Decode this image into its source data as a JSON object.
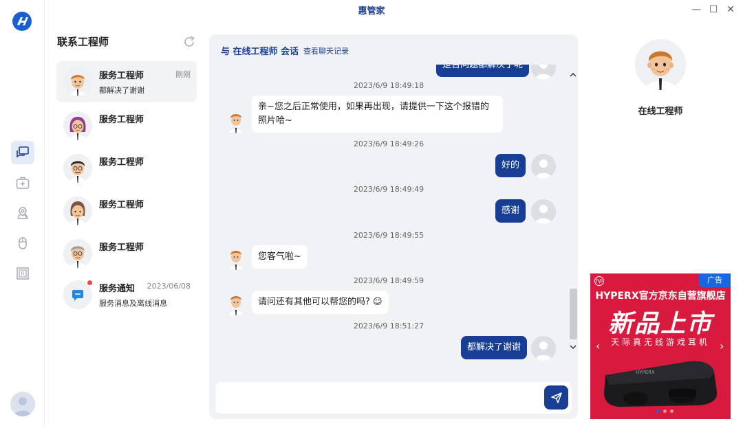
{
  "window": {
    "title": "惠管家",
    "minimize_label": "—",
    "maximize_label": "☐",
    "close_label": "✕"
  },
  "rail": {
    "items": [
      {
        "name": "chat-icon",
        "active": true
      },
      {
        "name": "medical-kit-icon",
        "active": false
      },
      {
        "name": "location-icon",
        "active": false
      },
      {
        "name": "mouse-icon",
        "active": false
      },
      {
        "name": "registered-icon",
        "active": false
      }
    ]
  },
  "contacts": {
    "title": "联系工程师",
    "items": [
      {
        "name": "服务工程师",
        "time": "刚刚",
        "last_message": "都解决了谢谢",
        "selected": true
      },
      {
        "name": "服务工程师",
        "time": "",
        "last_message": "",
        "selected": false
      },
      {
        "name": "服务工程师",
        "time": "",
        "last_message": "",
        "selected": false
      },
      {
        "name": "服务工程师",
        "time": "",
        "last_message": "",
        "selected": false
      },
      {
        "name": "服务工程师",
        "time": "",
        "last_message": "",
        "selected": false
      },
      {
        "name": "服务通知",
        "time": "2023/06/08",
        "last_message": "服务消息及离线消息",
        "selected": false
      }
    ]
  },
  "chat": {
    "title": "与 在线工程师 会话",
    "history_link": "查看聊天记录",
    "partial_top_message": "是否问题都解决了呢",
    "messages": [
      {
        "time": "2023/6/9 18:49:18",
        "from": "engineer",
        "text": "亲~您之后正常使用，如果再出现，请提供一下这个报错的照片哈~"
      },
      {
        "time": "2023/6/9 18:49:26",
        "from": "user",
        "text": "好的"
      },
      {
        "time": "2023/6/9 18:49:49",
        "from": "user",
        "text": "感谢"
      },
      {
        "time": "2023/6/9 18:49:55",
        "from": "engineer",
        "text": "您客气啦~"
      },
      {
        "time": "2023/6/9 18:49:59",
        "from": "engineer",
        "text": "请问还有其他可以帮您的吗? ☺"
      },
      {
        "time": "2023/6/9 18:51:27",
        "from": "user",
        "text": "都解决了谢谢"
      }
    ],
    "input_value": "",
    "input_placeholder": ""
  },
  "engineer_panel": {
    "name": "在线工程师"
  },
  "ad": {
    "tag": "广告",
    "brand_mark": "hp",
    "headline": "HYPERX官方京东自营旗舰店",
    "big_text": "新品上市",
    "subtitle": "天际真无线游戏耳机",
    "prev_arrow": "‹",
    "next_arrow": "›"
  },
  "colors": {
    "brand_blue": "#173e94",
    "title_blue": "#1d3f8f",
    "chat_bg": "#f1f2f5",
    "ad_red": "#d81a3e",
    "notify_dot": "#f04848"
  }
}
